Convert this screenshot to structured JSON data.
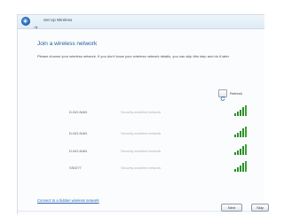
{
  "window": {
    "title": "Set Up Wireless"
  },
  "page": {
    "heading": "Join a wireless network",
    "description": "Please choose your wireless network. If you don't know your wireless network details, you can skip this step and do it later."
  },
  "toolbar": {
    "refresh_label": "Refresh"
  },
  "networks": [
    {
      "ssid": "D-NO-NAN",
      "security": "Security-enabled network",
      "signal_bars": 4
    },
    {
      "ssid": "D-NO-NAN",
      "security": "Security-enabled network",
      "signal_bars": 4
    },
    {
      "ssid": "D-NO-NAN",
      "security": "Security-enabled network",
      "signal_bars": 4
    },
    {
      "ssid": "SSID77",
      "security": "Security-enabled network",
      "signal_bars": 4
    }
  ],
  "links": {
    "hidden_network": "Connect to a hidden wireless network"
  },
  "buttons": {
    "next": "Next",
    "skip": "Skip"
  },
  "colors": {
    "heading": "#1f5c9e",
    "link": "#2a66b8",
    "signal": "#2f8f2a"
  }
}
